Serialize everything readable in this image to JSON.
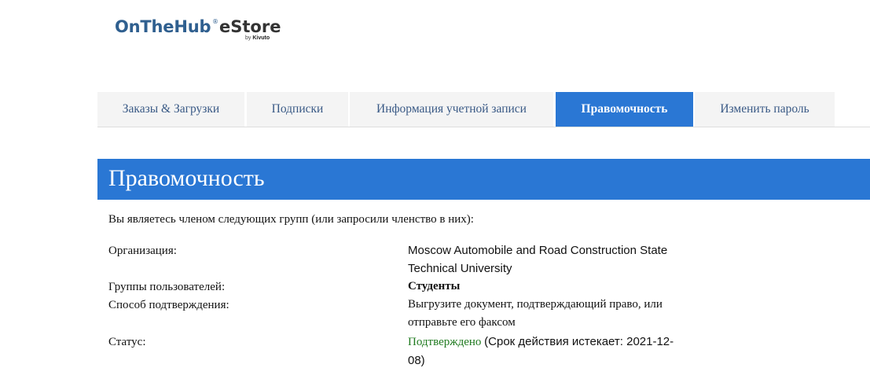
{
  "logo": {
    "main": "OnTheHub",
    "reg": "®",
    "estore": "eStore",
    "by": "by",
    "by_brand": "Kivuto"
  },
  "tabs": [
    {
      "label": "Заказы & Загрузки"
    },
    {
      "label": "Подписки"
    },
    {
      "label": "Информация учетной записи"
    },
    {
      "label": "Правомочность"
    },
    {
      "label": "Изменить пароль"
    }
  ],
  "section": {
    "title": "Правомочность",
    "intro": "Вы являетесь членом следующих групп (или запросили членство в них):"
  },
  "details": {
    "organization_label": "Организация:",
    "organization_value": "Moscow Automobile and Road Construction State Technical University",
    "groups_label": "Группы пользователей:",
    "groups_value": "Студенты",
    "method_label": "Способ подтверждения:",
    "method_value": "Выгрузите документ, подтверждающий право, или отправьте его факсом",
    "status_label": "Статус:",
    "status_value": "Подтверждено",
    "status_expiry": "(Срок действия истекает: 2021-12-08)"
  },
  "colors": {
    "accent": "#2a77d4",
    "tab_text": "#3a5a86",
    "tab_bg": "#f4f4f4",
    "status_ok": "#1f7a1f"
  }
}
